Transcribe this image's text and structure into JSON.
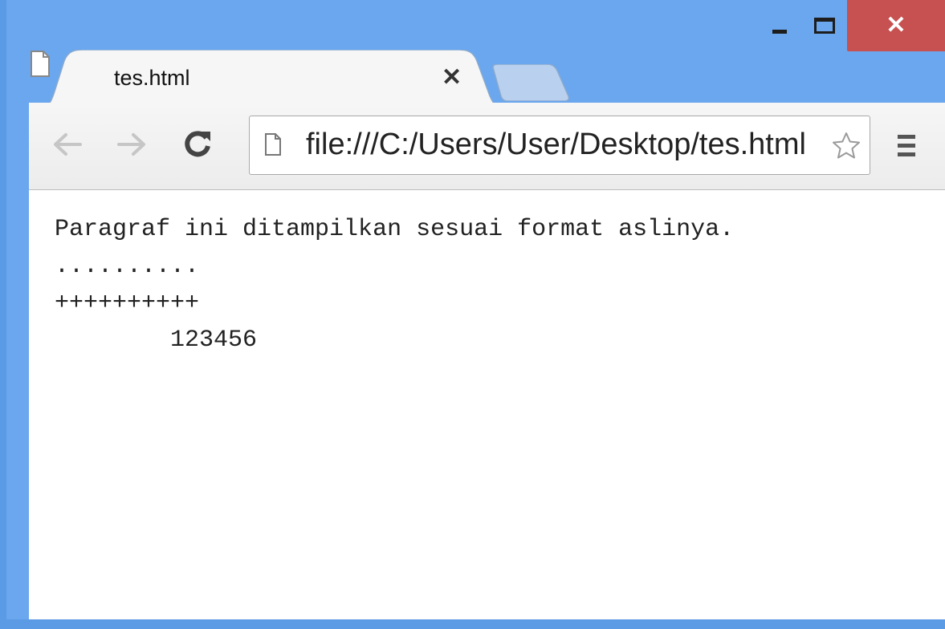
{
  "window": {
    "controls": {
      "minimize_icon": "minimize-icon",
      "maximize_icon": "maximize-icon",
      "close_glyph": "✕"
    }
  },
  "tab": {
    "title": "tes.html",
    "close_glyph": "✕"
  },
  "toolbar": {
    "back_icon": "back-arrow-icon",
    "forward_icon": "forward-arrow-icon",
    "reload_icon": "reload-icon",
    "url": "file:///C:/Users/User/Desktop/tes.html",
    "star_icon": "star-icon",
    "menu_icon": "hamburger-menu-icon"
  },
  "page": {
    "line1": "Paragraf ini ditampilkan sesuai format aslinya.",
    "line2": "..........",
    "line3": "++++++++++",
    "line4": "        123456"
  },
  "colors": {
    "frame": "#6aa7ee",
    "close_button": "#c75050"
  }
}
